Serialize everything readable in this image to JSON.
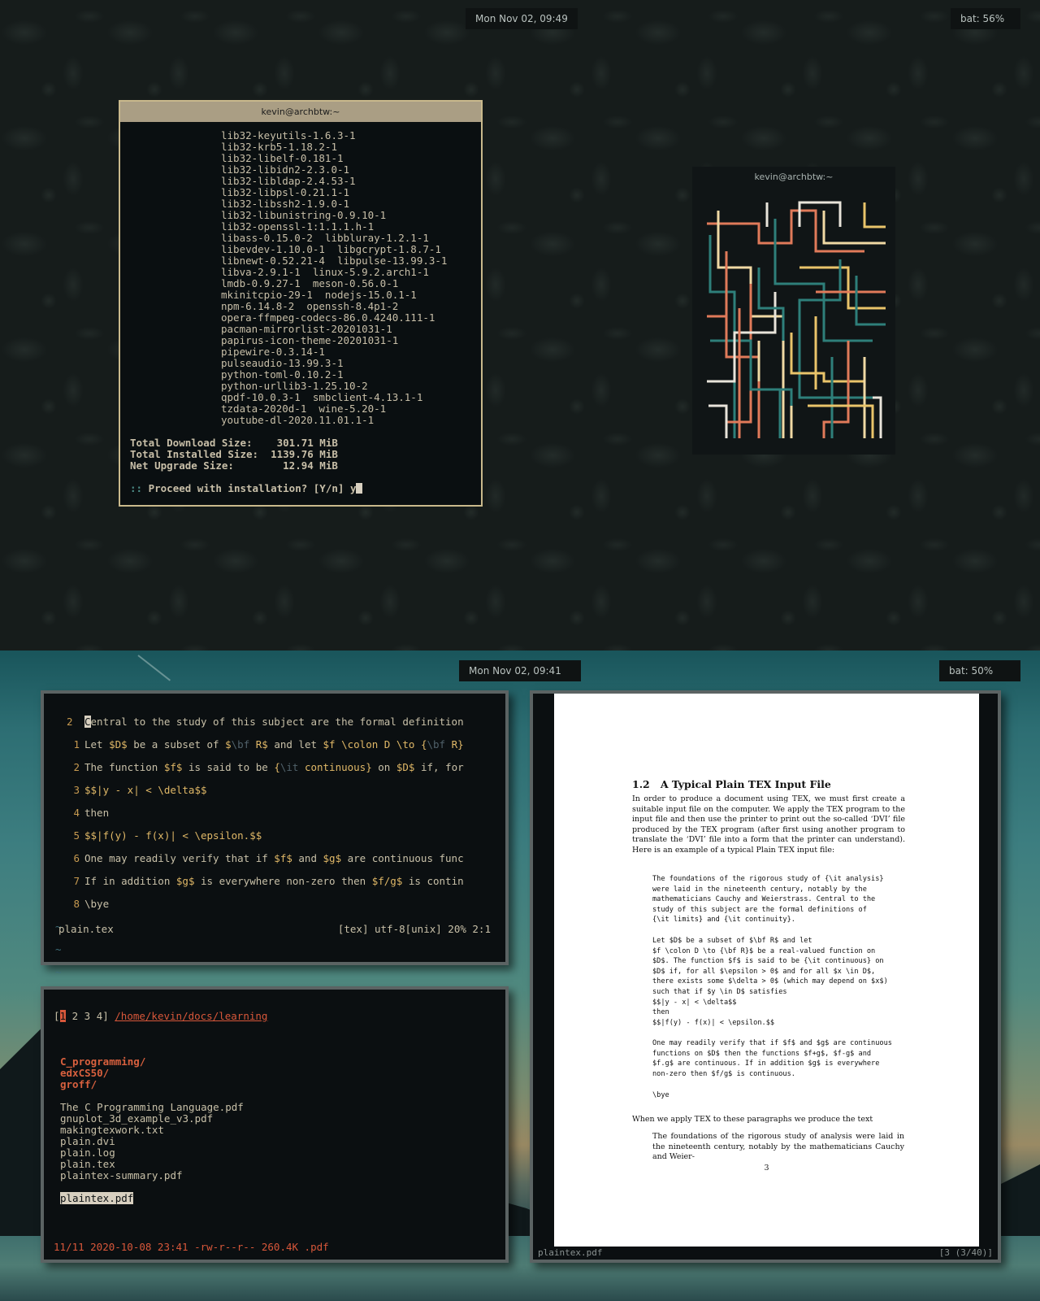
{
  "top_bar": {
    "clock": "Mon Nov 02, 09:49",
    "battery": "bat: 56%"
  },
  "terminal_main": {
    "title": "kevin@archbtw:~",
    "packages": [
      "lib32-keyutils-1.6.3-1",
      "lib32-krb5-1.18.2-1",
      "lib32-libelf-0.181-1",
      "lib32-libidn2-2.3.0-1",
      "lib32-libldap-2.4.53-1",
      "lib32-libpsl-0.21.1-1",
      "lib32-libssh2-1.9.0-1",
      "lib32-libunistring-0.9.10-1",
      "lib32-openssl-1:1.1.1.h-1",
      "libass-0.15.0-2  libbluray-1.2.1-1",
      "libevdev-1.10.0-1  libgcrypt-1.8.7-1",
      "libnewt-0.52.21-4  libpulse-13.99.3-1",
      "libva-2.9.1-1  linux-5.9.2.arch1-1",
      "lmdb-0.9.27-1  meson-0.56.0-1",
      "mkinitcpio-29-1  nodejs-15.0.1-1",
      "npm-6.14.8-2  openssh-8.4p1-2",
      "opera-ffmpeg-codecs-86.0.4240.111-1",
      "pacman-mirrorlist-20201031-1",
      "papirus-icon-theme-20201031-1",
      "pipewire-0.3.14-1",
      "pulseaudio-13.99.3-1",
      "python-toml-0.10.2-1",
      "python-urllib3-1.25.10-2",
      "qpdf-10.0.3-1  smbclient-4.13.1-1",
      "tzdata-2020d-1  wine-5.20-1",
      "youtube-dl-2020.11.01.1-1"
    ],
    "summary": [
      "Total Download Size:    301.71 MiB",
      "Total Installed Size:  1139.76 MiB",
      "Net Upgrade Size:        12.94 MiB"
    ],
    "prompt_marker": "::",
    "prompt_text": " Proceed with installation? [Y/n] ",
    "prompt_input": "y"
  },
  "terminal_pipes": {
    "title": "kevin@archbtw:~",
    "colors": {
      "orange": "#e07a5a",
      "teal": "#2e7f7a",
      "cream": "#f0d9a4",
      "yellow": "#e9c46a",
      "white": "#e8e4da"
    }
  },
  "bottom_bar": {
    "clock": "Mon Nov 02, 09:41",
    "battery": "bat: 50%"
  },
  "vim": {
    "cursor_line_no": "2",
    "cursor_char": "C",
    "cursor_line_rest": "entral to the study of this subject are the formal definition",
    "line_numbers": [
      "1",
      "2",
      "3",
      "4",
      "5",
      "6",
      "7",
      "8"
    ],
    "line1": {
      "a": "Let ",
      "b": "$D$",
      "c": " be a subset of ",
      "d": "$",
      "e": "\\bf",
      "f": " R$",
      "g": " and let ",
      "h": "$f \\colon D \\to {",
      "i": "\\bf",
      "j": " R}"
    },
    "line2": {
      "a": "The function ",
      "b": "$f$",
      "c": " is said to be ",
      "d": "{",
      "e": "\\it",
      "f": " continuous}",
      "g": " on ",
      "h": "$D$",
      "i": " if, for"
    },
    "line3": "$$|y - x| < \\delta$$",
    "line4": "then",
    "line5": "$$|f(y) - f(x)| < \\epsilon.$$",
    "line6": {
      "a": "One may readily verify that if ",
      "b": "$f$",
      "c": " and ",
      "d": "$g$",
      "e": " are continuous func"
    },
    "line7": {
      "a": "If in addition ",
      "b": "$g$",
      "c": " is everywhere non-zero then ",
      "d": "$f/g$",
      "e": " is contin"
    },
    "line8": "\\bye",
    "tilde": "~",
    "status_file": "plain.tex",
    "status_info": "[tex] utf-8[unix] 20% 2:1"
  },
  "file_manager": {
    "tab_open": "[",
    "tab_active": "1",
    "tabs_rest": " 2 3 4]",
    "path": "/home/kevin/docs/learning",
    "dirs": [
      "C_programming/",
      "edxCS50/",
      "groff/"
    ],
    "files": [
      "The C Programming Language.pdf",
      "gnuplot_3d_example_v3.pdf",
      "makingtexwork.txt",
      "plain.dvi",
      "plain.log",
      "plain.tex",
      "plaintex-summary.pdf"
    ],
    "selected_file": "plaintex.pdf",
    "status": "11/11 2020-10-08 23:41 -rw-r--r-- 260.4K .pdf"
  },
  "pdf_viewer": {
    "heading_number": "1.2",
    "heading_title": "A Typical Plain TEX Input File",
    "intro": "In order to produce a document using TEX, we must first create a suitable input file on the computer. We apply the TEX program to the input file and then use the printer to print out the so-called ‘DVI’ file produced by the TEX program (after first using another program to translate the ‘DVI’ file into a form that the printer can understand). Here is an example of a typical Plain TEX input file:",
    "code1": "The foundations of the rigorous study of {\\it analysis}\nwere laid in the nineteenth century, notably by the\nmathematicians Cauchy and Weierstrass. Central to the\nstudy of this subject are the formal definitions of\n{\\it limits} and {\\it continuity}.",
    "code2": "Let $D$ be a subset of $\\bf R$ and let\n$f \\colon D \\to {\\bf R}$ be a real-valued function on\n$D$. The function $f$ is said to be {\\it continuous} on\n$D$ if, for all $\\epsilon > 0$ and for all $x \\in D$,\nthere exists some $\\delta > 0$ (which may depend on $x$)\nsuch that if $y \\in D$ satisfies\n$$|y - x| < \\delta$$\nthen\n$$|f(y) - f(x)| < \\epsilon.$$",
    "code3": "One may readily verify that if $f$ and $g$ are continuous\nfunctions on $D$ then the functions $f+g$, $f-g$ and\n$f.g$ are continuous. If in addition $g$ is everywhere\nnon-zero then $f/g$ is continuous.",
    "code4": "\\bye",
    "after_text": "When we apply TEX to these paragraphs we produce the text",
    "result_text": "The foundations of the rigorous study of analysis were laid in the nineteenth century, notably by the mathematicians Cauchy and Weier-",
    "page_number": "3",
    "status_file": "plaintex.pdf",
    "status_page": "[3 (3/40)]"
  }
}
